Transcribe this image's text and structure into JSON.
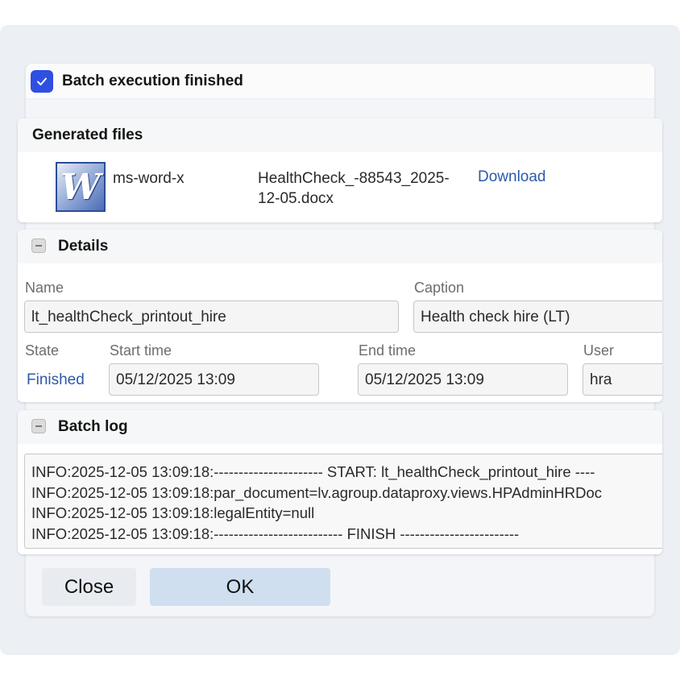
{
  "dialog": {
    "title": "Batch execution finished",
    "accent_color": "#2f4fe0"
  },
  "generated_files": {
    "title": "Generated files",
    "file": {
      "icon": "word-document-icon",
      "type": "ms-word-x",
      "name_line1": "HealthCheck_-88543_2025-",
      "name_line2": "12-05.docx",
      "download_label": "Download"
    }
  },
  "details": {
    "title": "Details",
    "name_label": "Name",
    "name_value": "lt_healthCheck_printout_hire",
    "caption_label": "Caption",
    "caption_value": "Health check hire (LT)",
    "state_label": "State",
    "state_value": "Finished",
    "start_label": "Start time",
    "start_value": "05/12/2025 13:09",
    "end_label": "End time",
    "end_value": "05/12/2025 13:09",
    "user_label": "User",
    "user_value": "hra"
  },
  "batch_log": {
    "title": "Batch log",
    "lines": [
      "INFO:2025-12-05 13:09:18:---------------------- START: lt_healthCheck_printout_hire ----",
      "INFO:2025-12-05 13:09:18:par_document=lv.agroup.dataproxy.views.HPAdminHRDoc",
      "INFO:2025-12-05 13:09:18:legalEntity=null",
      "INFO:2025-12-05 13:09:18:-------------------------- FINISH ------------------------"
    ]
  },
  "buttons": {
    "close_label": "Close",
    "ok_label": "OK"
  }
}
